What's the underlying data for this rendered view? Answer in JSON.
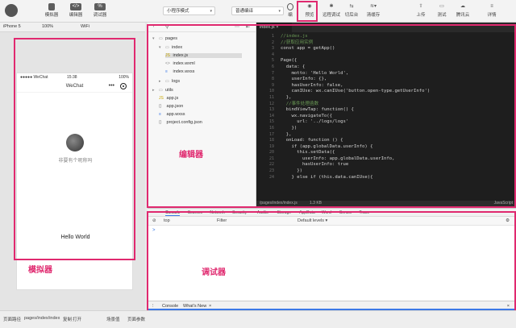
{
  "toolbar": {
    "buttons": [
      {
        "label": "模拟器",
        "icon": "phone-icon"
      },
      {
        "label": "编辑器",
        "icon": "code-icon"
      },
      {
        "label": "调试器",
        "icon": "bug-icon"
      },
      {
        "label": "编",
        "icon": "compile-icon"
      },
      {
        "label": "预览",
        "icon": "eye-icon"
      },
      {
        "label": "远程调试",
        "icon": "remote-debug-icon"
      },
      {
        "label": "切后台",
        "icon": "background-icon"
      },
      {
        "label": "清缓存",
        "icon": "layers-icon"
      },
      {
        "label": "上传",
        "icon": "upload-icon"
      },
      {
        "label": "测试",
        "icon": "test-icon"
      },
      {
        "label": "腾讯云",
        "icon": "cloud-icon"
      },
      {
        "label": "详情",
        "icon": "menu-icon"
      }
    ],
    "mode_select": "小程序模式",
    "compile_select": "普通编译"
  },
  "subbar": {
    "device": "iPhone 5",
    "zoom": "100%",
    "network": "WiFi"
  },
  "phone": {
    "carrier": "●●●●● WeChat",
    "time": "15:38",
    "battery": "100%",
    "nav_title": "WeChat",
    "nav_dots": "•••",
    "nickname": "非要有个昵称吗",
    "hello": "Hello World"
  },
  "labels": {
    "simulator": "模拟器",
    "editor": "编辑器",
    "debugger": "调试器"
  },
  "tree": {
    "items": [
      {
        "label": "pages",
        "indent": 0,
        "arrow": "▾",
        "icon": "folder"
      },
      {
        "label": "index",
        "indent": 1,
        "arrow": "▾",
        "icon": "folder"
      },
      {
        "label": "index.js",
        "indent": 2,
        "arrow": "",
        "icon": "js"
      },
      {
        "label": "index.wxml",
        "indent": 2,
        "arrow": "",
        "icon": "wxml"
      },
      {
        "label": "index.wxss",
        "indent": 2,
        "arrow": "",
        "icon": "wxss"
      },
      {
        "label": "logs",
        "indent": 1,
        "arrow": "▸",
        "icon": "folder"
      },
      {
        "label": "utils",
        "indent": 0,
        "arrow": "▸",
        "icon": "folder"
      },
      {
        "label": "app.js",
        "indent": 0,
        "arrow": "",
        "icon": "js"
      },
      {
        "label": "app.json",
        "indent": 0,
        "arrow": "",
        "icon": "json"
      },
      {
        "label": "app.wxss",
        "indent": 0,
        "arrow": "",
        "icon": "wxss"
      },
      {
        "label": "project.config.json",
        "indent": 0,
        "arrow": "",
        "icon": "json"
      }
    ]
  },
  "editor": {
    "tab": "index.js",
    "status_path": "/pages/index/index.js",
    "status_size": "1.3 KB",
    "status_lang": "JavaScript",
    "lines": [
      "//index.js",
      "//获取应用实例",
      "const app = getApp()",
      "",
      "Page({",
      "  data: {",
      "    motto: 'Hello World',",
      "    userInfo: {},",
      "    hasUserInfo: false,",
      "    canIUse: wx.canIUse('button.open-type.getUserInfo')",
      "  },",
      "  //事件处理函数",
      "  bindViewTap: function() {",
      "    wx.navigateTo({",
      "      url: '../logs/logs'",
      "    })",
      "  },",
      "  onLoad: function () {",
      "    if (app.globalData.userInfo) {",
      "      this.setData({",
      "        userInfo: app.globalData.userInfo,",
      "        hasUserInfo: true",
      "      })",
      "    } else if (this.data.canIUse){"
    ]
  },
  "debugger": {
    "tabs": [
      "Console",
      "Sources",
      "Network",
      "Security",
      "Audits",
      "Storage",
      "AppData",
      "Wxml",
      "Sensor",
      "Trace"
    ],
    "context": "top",
    "filter": "Filter",
    "levels": "Default levels ▾",
    "prompt": ">",
    "drawer_tabs": [
      "Console",
      "What's New"
    ]
  },
  "bottombar": {
    "path_label": "页面路径",
    "path": "pages/index/index",
    "copy": "复制",
    "open": "打开",
    "scene": "场景值",
    "params": "页面参数"
  },
  "colors": {
    "highlight": "#e0296f",
    "editor_bg": "#1e1e1e",
    "link": "#3b78e7"
  }
}
